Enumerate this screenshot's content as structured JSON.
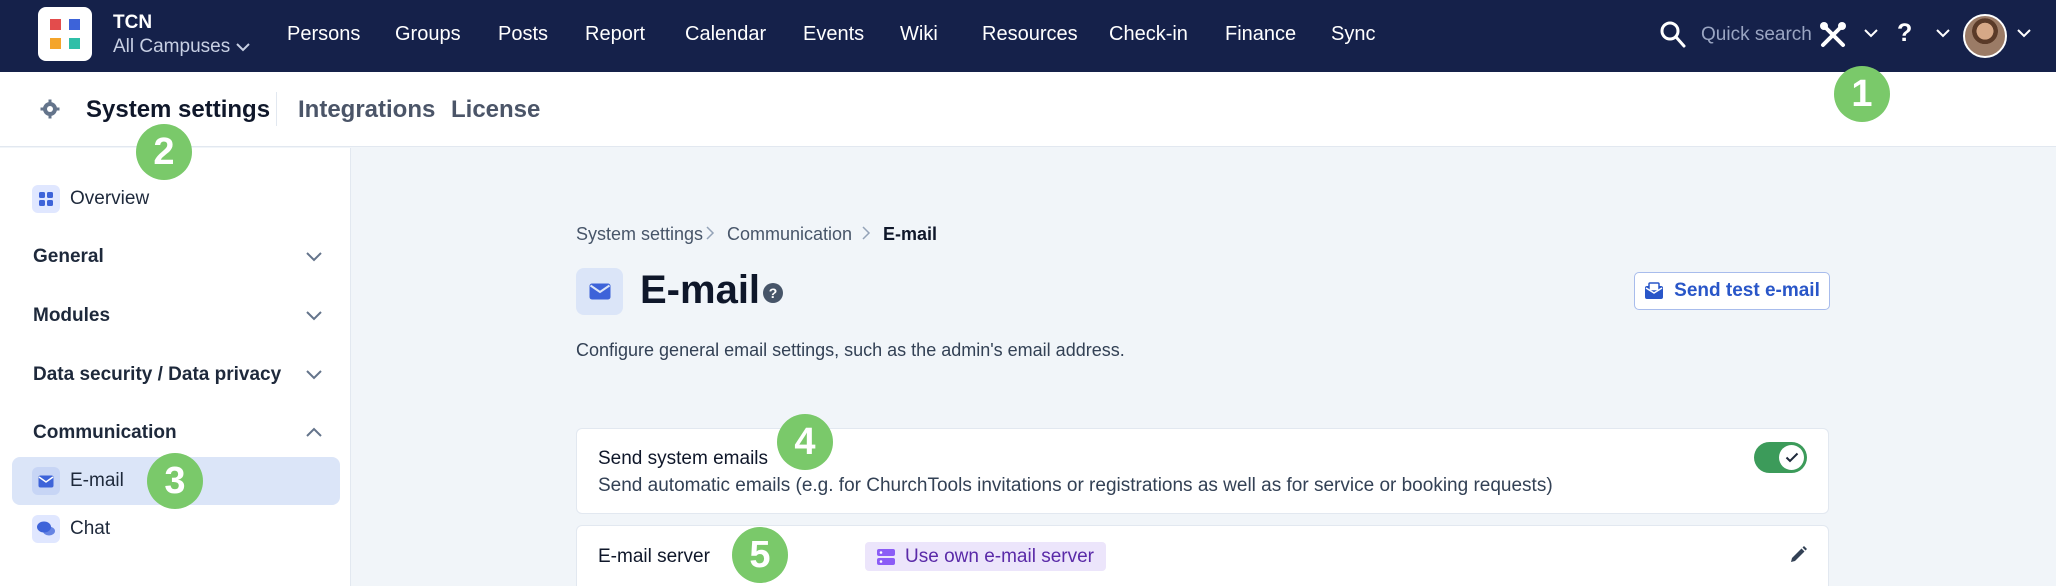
{
  "brand": {
    "name": "TCN",
    "campus": "All Campuses"
  },
  "nav": [
    "Persons",
    "Groups",
    "Posts",
    "Report",
    "Calendar",
    "Events",
    "Wiki",
    "Resources",
    "Check-in",
    "Finance",
    "Sync"
  ],
  "search": {
    "placeholder": "Quick search"
  },
  "help_glyph": "?",
  "tabs": {
    "active": "System settings",
    "integrations": "Integrations",
    "license": "License"
  },
  "sidebar": {
    "overview": "Overview",
    "general": "General",
    "modules": "Modules",
    "data_security": "Data security / Data privacy",
    "communication": "Communication",
    "email": "E-mail",
    "chat": "Chat"
  },
  "breadcrumb": [
    "System settings",
    "Communication",
    "E-mail"
  ],
  "page": {
    "title": "E-mail",
    "info_glyph": "?",
    "test_button": "Send test e-mail",
    "description": "Configure general email settings, such as the admin's email address."
  },
  "settings": {
    "system_emails": {
      "title": "Send system emails",
      "description": "Send automatic emails (e.g. for ChurchTools invitations or registrations as well as for service or booking requests)",
      "enabled": true
    },
    "server": {
      "title": "E-mail server",
      "value": "Use own e-mail server"
    }
  },
  "markers": [
    "1",
    "2",
    "3",
    "4",
    "5"
  ],
  "colors": {
    "nav_bg": "#15214a",
    "accent": "#2956c8",
    "toggle_on": "#3c9b5a",
    "marker": "#7ac96a",
    "badge_bg": "#ece5fb"
  }
}
